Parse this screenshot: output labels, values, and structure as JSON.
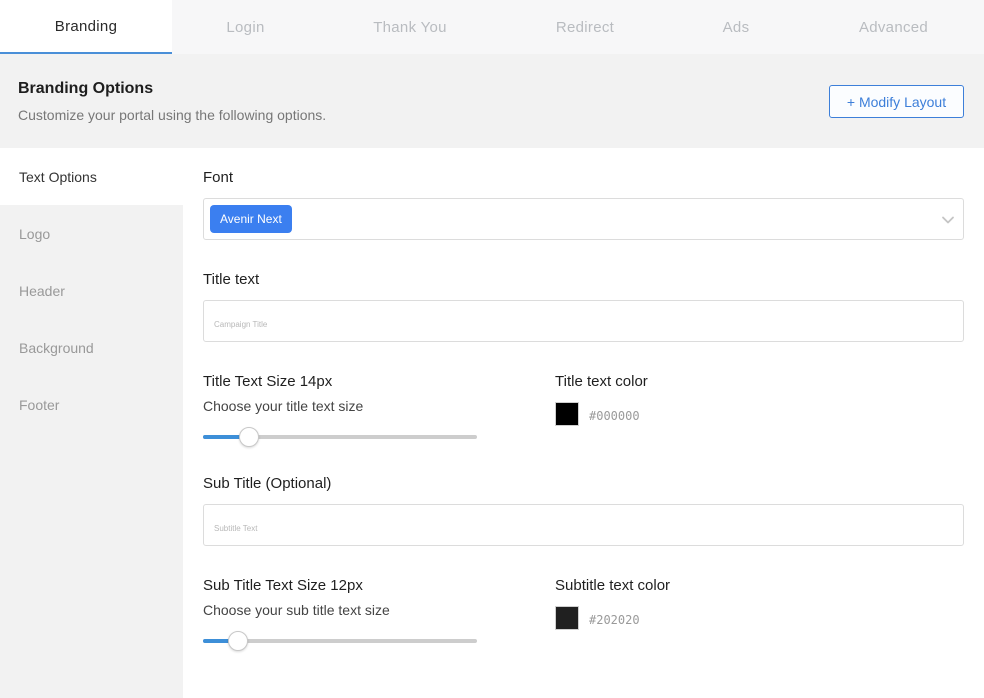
{
  "tabs": [
    {
      "label": "Branding",
      "active": true
    },
    {
      "label": "Login",
      "active": false
    },
    {
      "label": "Thank You",
      "active": false
    },
    {
      "label": "Redirect",
      "active": false
    },
    {
      "label": "Ads",
      "active": false
    },
    {
      "label": "Advanced",
      "active": false
    }
  ],
  "header": {
    "title": "Branding Options",
    "subtitle": "Customize your portal using the following options.",
    "modify_button": "+ Modify Layout"
  },
  "sidebar": {
    "items": [
      {
        "label": "Text Options",
        "active": true
      },
      {
        "label": "Logo",
        "active": false
      },
      {
        "label": "Header",
        "active": false
      },
      {
        "label": "Background",
        "active": false
      },
      {
        "label": "Footer",
        "active": false
      }
    ]
  },
  "form": {
    "font_label": "Font",
    "font_value": "Avenir Next",
    "title_text_label": "Title text",
    "title_text_placeholder": "Campaign Title",
    "title_size_label": "Title Text Size 14px",
    "title_size_hint": "Choose your title text size",
    "title_size_slider_fraction": 0.14,
    "title_color_label": "Title text color",
    "title_color_value": "#000000",
    "subtitle_label": "Sub Title (Optional)",
    "subtitle_placeholder": "Subtitle Text",
    "subtitle_size_label": "Sub Title Text Size 12px",
    "subtitle_size_hint": "Choose your sub title text size",
    "subtitle_size_slider_fraction": 0.1,
    "subtitle_color_label": "Subtitle text color",
    "subtitle_color_value": "#202020"
  },
  "colors": {
    "accent": "#3d7fd9",
    "chip": "#3b7ff0",
    "slider_fill": "#3d8fd8"
  },
  "icons": {
    "font_select_chevron": "chevron-down-icon"
  }
}
